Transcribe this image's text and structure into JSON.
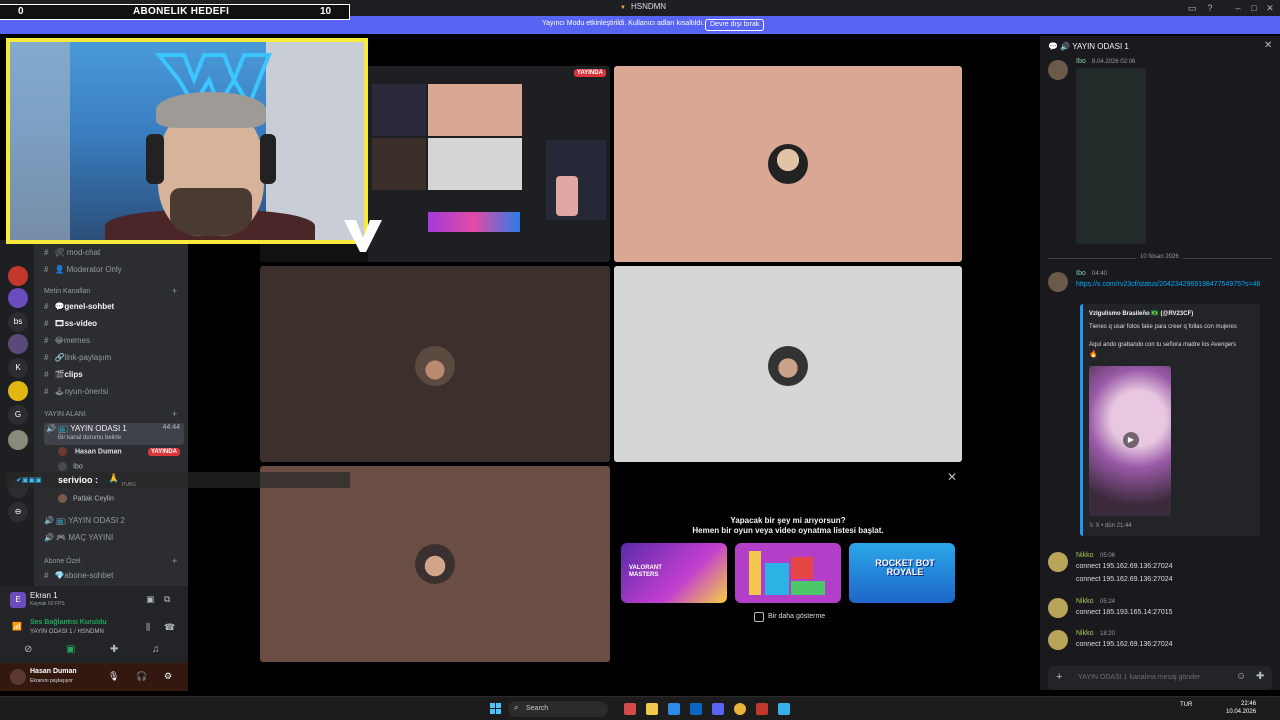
{
  "window": {
    "title": "HSNDMN"
  },
  "stream_overlay": {
    "goal_left": "0",
    "goal_title": "ABONELIK HEDEFI",
    "goal_value": "10",
    "chat_user": "serivioo :",
    "chat_extra": "PUBG"
  },
  "notice": {
    "text": "Yayıncı Modu etkinleştirildi. Kullanıcı adları kısaltıldı.",
    "button": "Devre dışı bırak"
  },
  "server_rail": {
    "items": [
      {
        "label": "bs"
      },
      {
        "label": "K"
      },
      {
        "label": "G"
      }
    ],
    "badge": "14"
  },
  "channels": {
    "top_channel_truncated": "moderator-chat",
    "items_top": [
      {
        "label": "mod-chat"
      },
      {
        "label": "Moderator Only"
      }
    ],
    "text_category": "Metin Kanalları",
    "text_channels": [
      {
        "label": "genel-sohbet"
      },
      {
        "label": "ss-video"
      },
      {
        "label": "memes"
      },
      {
        "label": "link-paylaşım"
      },
      {
        "label": "clips"
      },
      {
        "label": "oyun-önerisi"
      }
    ],
    "voice_category": "YAYIN ALANI",
    "voice_room": "YAYIN ODASI 1",
    "voice_timer": "44:44",
    "voice_status": "Bir kanal durumu belirle",
    "voice_members": [
      {
        "name": "Hasan Duman",
        "live": "YAYINDA"
      },
      {
        "name": "Ibo",
        "live": ""
      },
      {
        "name": "Patlak Ceylin",
        "live": ""
      }
    ],
    "voice_room2": "YAYIN ODASI 2",
    "voice_room3": "MAÇ YAYINI",
    "sub_category": "Abone Özel",
    "sub_channel": "abone-sohbet"
  },
  "user_panel": {
    "screen_label": "Ekran 1",
    "screen_sub": "Kaynak 60 FPS",
    "voice_connected": "Ses Bağlantısı Kuruldu",
    "voice_channel": "YAYIN ODASI 1 / HSNDMN",
    "username": "Hasan Duman",
    "user_status": "Ekranını paylaşıyor"
  },
  "stream_preview": {
    "live_badge": "YAYINDA"
  },
  "activity": {
    "title": "Yapacak bir şey mi arıyorsun?",
    "subtitle": "Hemen bir oyun veya video oynatma listesi başlat.",
    "checkbox_label": "Bir daha gösterme",
    "cards": [
      {
        "name": "valorant-masters-card",
        "text": "VALORANT MASTERS"
      },
      {
        "name": "blocks-card",
        "text": ""
      },
      {
        "name": "rocket-bot-royale-card",
        "text": "ROCKET BOT ROYALE"
      }
    ]
  },
  "chat": {
    "title": "YAYIN ODASI 1",
    "msg1": {
      "author": "Ibo",
      "time": "8.04.2026 02:06"
    },
    "date_divider": "10 Nisan 2026",
    "msg2": {
      "author": "Ibo",
      "time": "04:40",
      "link": "https://x.com/rv23cf/status/204234296919847754975?s=46",
      "embed_author": "Vzlgulismo Brasileño 🇧🇷 (@RV23CF)",
      "embed_line1": "Tienes q usar fotos fake para creer q follas con mujeres",
      "embed_line2": "Aquí ando grabando con tu señora madre los Avengers",
      "embed_footer": "X • dün 21:44"
    },
    "msg3": {
      "author": "Nikko",
      "time": "05:06",
      "lines": [
        "connect 195.162.69.136:27024",
        "connect 195.162.69.136:27024"
      ]
    },
    "msg4": {
      "author": "Nikko",
      "time": "05:24",
      "lines": [
        "connect 185.193.165.14:27015"
      ]
    },
    "msg5": {
      "author": "Nikko",
      "time": "18:20",
      "lines": [
        "connect 195.162.69.136:27024"
      ]
    },
    "input_placeholder": "YAYIN ODASI 1 kanalına mesaj gönder"
  },
  "taskbar": {
    "search_placeholder": "Search",
    "lang": "TUR",
    "time": "22:46",
    "date": "10.04.2026"
  }
}
